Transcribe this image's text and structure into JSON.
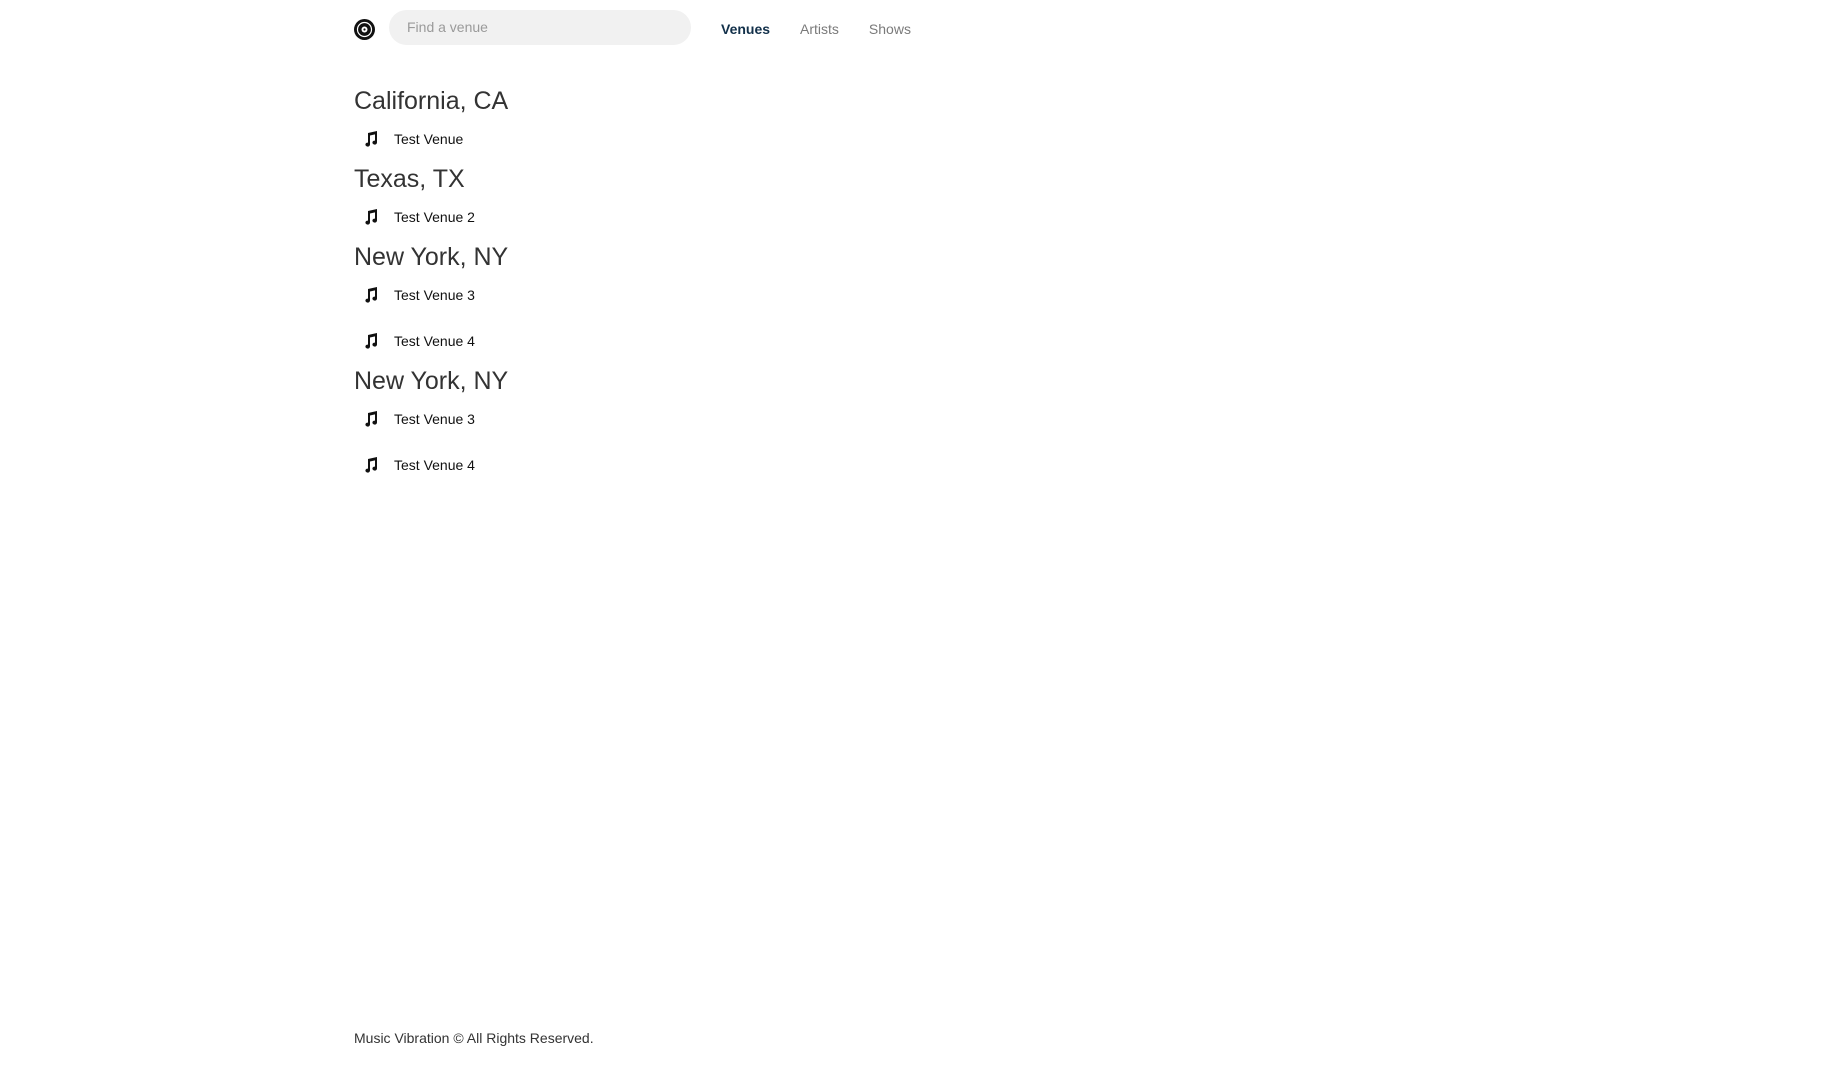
{
  "header": {
    "logo_icon": "vinyl-record-icon",
    "search": {
      "placeholder": "Find a venue",
      "value": ""
    },
    "nav": [
      {
        "label": "Venues",
        "active": true
      },
      {
        "label": "Artists",
        "active": false
      },
      {
        "label": "Shows",
        "active": false
      }
    ]
  },
  "groups": [
    {
      "title": "California, CA",
      "venues": [
        {
          "name": "Test Venue",
          "icon": "music-note-icon"
        }
      ]
    },
    {
      "title": "Texas, TX",
      "venues": [
        {
          "name": "Test Venue 2",
          "icon": "music-note-icon"
        }
      ]
    },
    {
      "title": "New York, NY",
      "venues": [
        {
          "name": "Test Venue 3",
          "icon": "music-note-icon"
        },
        {
          "name": "Test Venue 4",
          "icon": "music-note-icon"
        }
      ]
    },
    {
      "title": "New York, NY",
      "venues": [
        {
          "name": "Test Venue 3",
          "icon": "music-note-icon"
        },
        {
          "name": "Test Venue 4",
          "icon": "music-note-icon"
        }
      ]
    }
  ],
  "footer": {
    "text": "Music Vibration © All Rights Reserved."
  },
  "colors": {
    "nav_active": "#12304a",
    "nav_inactive": "#7a7a7a",
    "search_bg": "#f1f1f1"
  }
}
